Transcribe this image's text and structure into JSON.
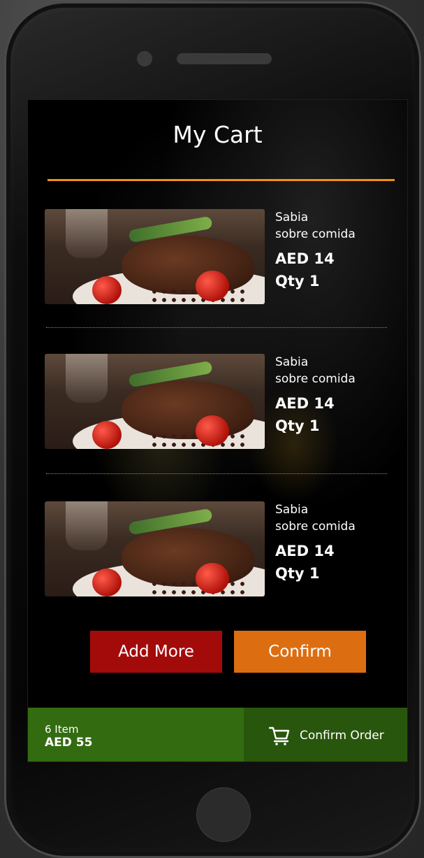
{
  "header": {
    "title": "My Cart"
  },
  "cart": {
    "items": [
      {
        "name": "Sabia",
        "description": "sobre comida",
        "price": "AED 14",
        "qty": "Qty 1",
        "image_icon": "steak-dish-photo"
      },
      {
        "name": "Sabia",
        "description": "sobre comida",
        "price": "AED 14",
        "qty": "Qty 1",
        "image_icon": "steak-dish-photo"
      },
      {
        "name": "Sabia",
        "description": "sobre comida",
        "price": "AED 14",
        "qty": "Qty 1",
        "image_icon": "steak-dish-photo"
      }
    ]
  },
  "actions": {
    "add_more_label": "Add More",
    "confirm_label": "Confirm"
  },
  "footer": {
    "item_count": "6 Item",
    "total": "AED 55",
    "confirm_order_label": "Confirm Order",
    "cart_icon": "shopping-cart-icon"
  },
  "colors": {
    "accent_rule": "#f0901a",
    "add_more_bg": "#a30b0b",
    "confirm_bg": "#dc6e11",
    "footer_left_bg": "#336b10",
    "footer_right_bg": "#28560c"
  }
}
